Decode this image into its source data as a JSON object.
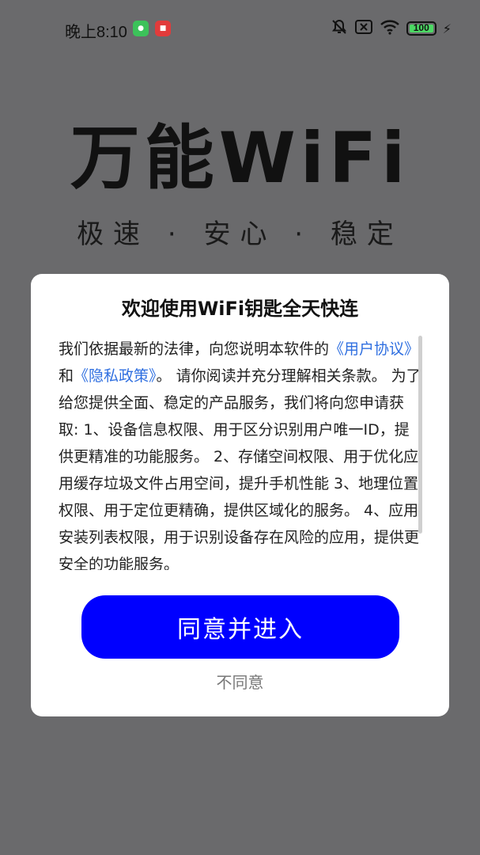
{
  "status_bar": {
    "time": "晚上8:10",
    "battery_label": "100",
    "battery_level_percent": 100
  },
  "brand": {
    "title": "万能WiFi",
    "tagline": "极速 · 安心 · 稳定"
  },
  "dialog": {
    "title": "欢迎使用WiFi钥匙全天快连",
    "body_intro": "我们依据最新的法律，向您说明本软件的",
    "user_agreement_link": "《用户协议》",
    "and_text": "和",
    "privacy_link": "《隐私政策》",
    "body_rest": "。 请你阅读并充分理解相关条款。 为了给您提供全面、稳定的产品服务，我们将向您申请获取: 1、设备信息权限、用于区分识别用户唯一ID，提供更精准的功能服务。 2、存储空间权限、用于优化应用缓存垃圾文件占用空间，提升手机性能 3、地理位置权限、用于定位更精确，提供区域化的服务。 4、应用安装列表权限，用于识别设备存在风险的应用，提供更安全的功能服务。",
    "agree_button": "同意并进入",
    "disagree_link": "不同意"
  },
  "colors": {
    "overlay_bg": "#6a6a6c",
    "primary_button": "#0000ff",
    "link": "#2f6fe0"
  }
}
